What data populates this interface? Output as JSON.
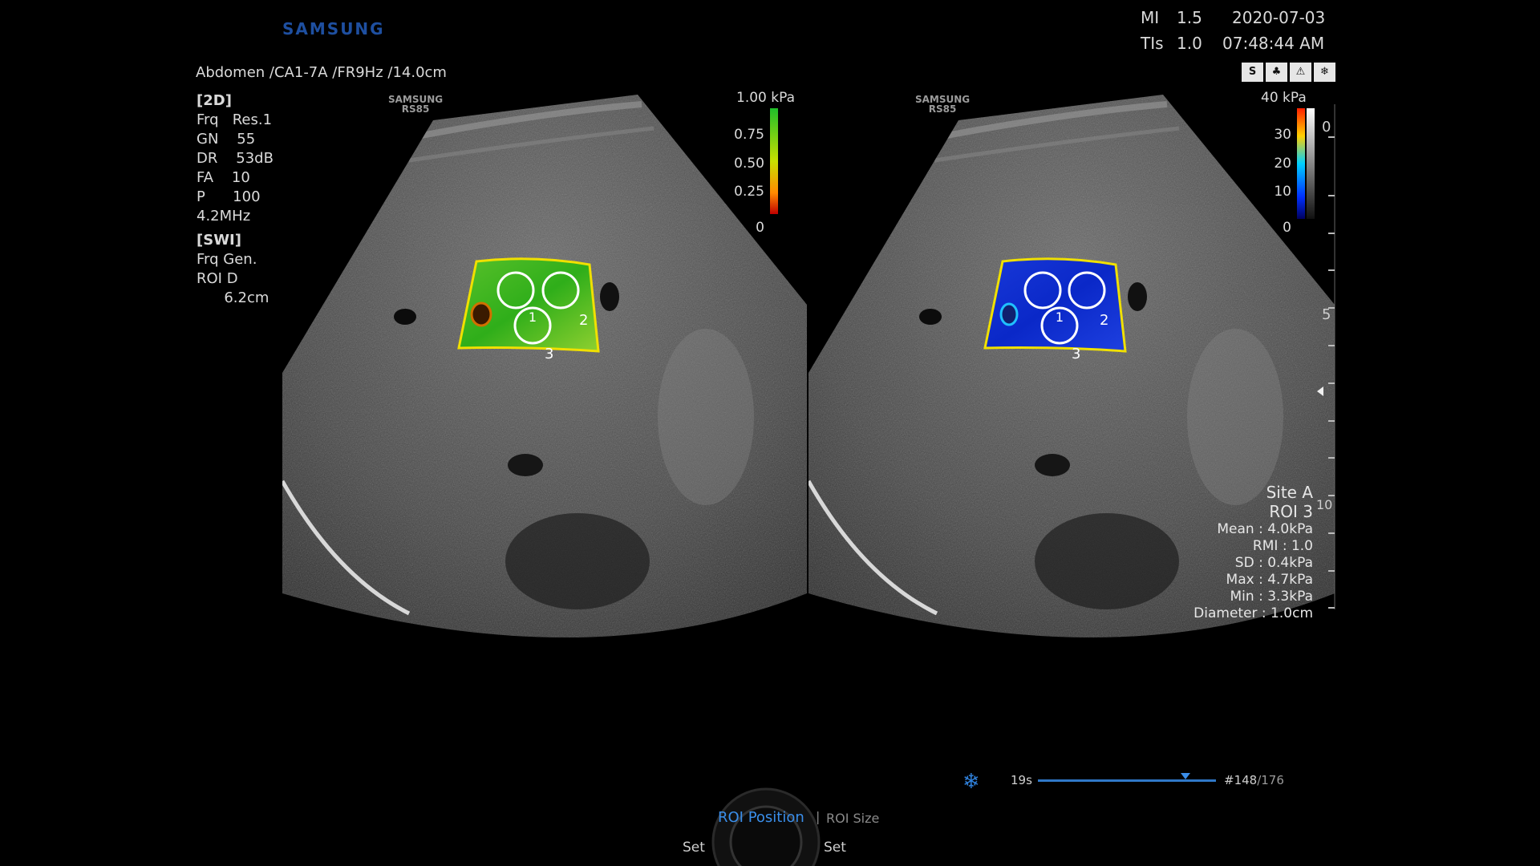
{
  "brand": "SAMSUNG",
  "header": {
    "mi_label": "MI",
    "mi_value": "1.5",
    "tis_label": "TIs",
    "tis_value": "1.0",
    "date": "2020-07-03",
    "time": "07:48:44 AM",
    "preset": "Abdomen /CA1-7A /FR9Hz /14.0cm"
  },
  "params_2d": {
    "section": "[2D]",
    "lines": [
      "Frq   Res.1",
      "GN    55",
      "DR    53dB",
      "FA    10",
      "P      100",
      "4.2MHz"
    ]
  },
  "params_swi": {
    "section": "[SWI]",
    "lines": [
      "Frq Gen.",
      "ROI D",
      "      6.2cm"
    ]
  },
  "left_image": {
    "watermark_line1": "SAMSUNG",
    "watermark_line2": "RS85",
    "scale_unit": "1.00  kPa",
    "scale_ticks": [
      "0.75",
      "0.50",
      "0.25",
      "0"
    ],
    "roi_labels": [
      "1",
      "2",
      "3"
    ]
  },
  "right_image": {
    "watermark_line1": "SAMSUNG",
    "watermark_line2": "RS85",
    "scale_unit": "40  kPa",
    "scale_ticks": [
      "30",
      "20",
      "10",
      "0"
    ],
    "roi_labels": [
      "1",
      "2",
      "3"
    ]
  },
  "depth_marks": [
    "0",
    "5",
    "10"
  ],
  "icon_buttons": [
    "S",
    "♣",
    "⚠",
    "❄"
  ],
  "measurement": {
    "site": "Site A",
    "roi": "ROI 3",
    "lines": [
      "Mean : 4.0kPa",
      "RMI : 1.0",
      "SD : 0.4kPa",
      "Max : 4.7kPa",
      "Min : 3.3kPa",
      "Diameter : 1.0cm"
    ]
  },
  "cine": {
    "duration": "19s",
    "frame": "#148",
    "total": "/176",
    "position_fraction": 0.83
  },
  "controls": {
    "roi_position": "ROI Position",
    "separator": "|",
    "roi_size": "ROI Size",
    "set_left": "Set",
    "set_right": "Set"
  }
}
